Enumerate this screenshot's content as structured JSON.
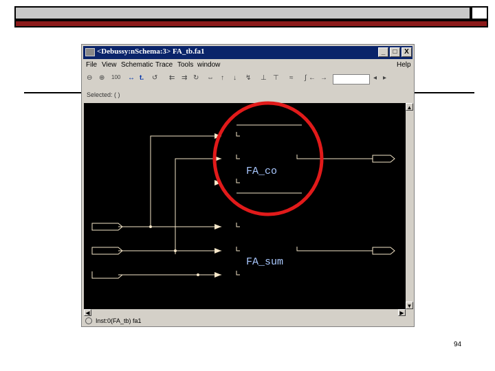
{
  "window": {
    "title": "<Debussy:nSchema:3> FA_tb.fa1",
    "controls": [
      "_",
      "□",
      "X"
    ]
  },
  "menu": {
    "items": [
      "File",
      "View",
      "Schematic",
      "Trace",
      "Tools",
      "window"
    ],
    "help": "Help"
  },
  "toolbar": {
    "buttons": [
      "zoom-out",
      "zoom-in",
      "zoom-100",
      "pointer",
      "trace",
      "undo",
      "redo",
      "hierarchy",
      "bus",
      "arrows",
      "net",
      "signal",
      "probe",
      "back",
      "forward"
    ]
  },
  "selected": {
    "label": "Selected: ( )"
  },
  "schematic": {
    "instances": [
      {
        "name": "FA_co"
      },
      {
        "name": "FA_sum"
      }
    ]
  },
  "statusbar": {
    "text": "Inst:0(FA_tb) fa1"
  },
  "slide": {
    "number": "94"
  },
  "colors": {
    "annotation": "#e11a1a",
    "wire": "#f5e6c8",
    "label": "#a9c8ff"
  }
}
